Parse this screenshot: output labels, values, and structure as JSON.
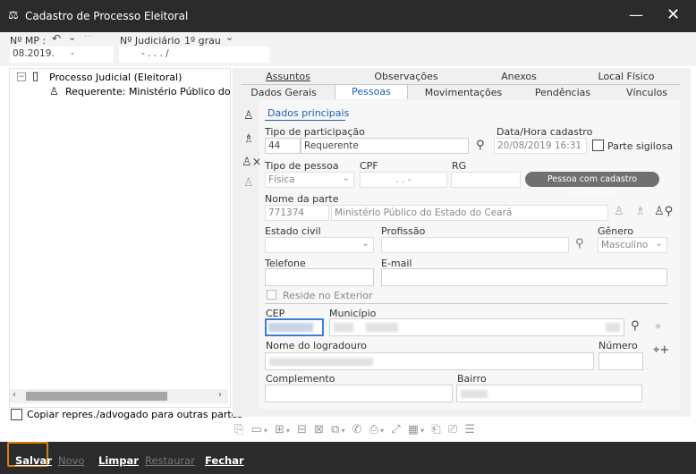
{
  "window": {
    "title": "Cadastro de Processo Eleitoral",
    "minimize_icon": "minimize-icon",
    "close_icon": "close-icon"
  },
  "header": {
    "mp_label": "Nº MP :",
    "mp_value": "08.2019.",
    "mp_value2": "-",
    "judiciario_label": "Nº Judiciário",
    "grau_label": "1º grau",
    "judiciario_value": "-    .    .  .    /"
  },
  "tree": {
    "root_label": "Processo Judicial (Eleitoral)",
    "child_label": "Requerente: Ministério Público do E",
    "copy_label": "Copiar repres./advogado para outras partes"
  },
  "tabs_row1": [
    "Assuntos",
    "Observações",
    "Anexos",
    "Local Físico"
  ],
  "tabs_row2": [
    "Dados Gerais",
    "Pessoas",
    "Movimentações",
    "Pendências",
    "Vínculos"
  ],
  "form": {
    "section_title": "Dados principais",
    "tipo_participacao_label": "Tipo de participação",
    "tipo_participacao_code": "44",
    "tipo_participacao_value": "Requerente",
    "data_hora_label": "Data/Hora cadastro",
    "data_hora_value": "20/08/2019 16:31",
    "parte_sigilosa_label": "Parte sigilosa",
    "tipo_pessoa_label": "Tipo de pessoa",
    "tipo_pessoa_value": "Física",
    "cpf_label": "CPF",
    "cpf_value": ".    .    -",
    "rg_label": "RG",
    "pessoa_controlado": "Pessoa com cadastro controlado",
    "nome_parte_label": "Nome da parte",
    "nome_parte_code": "771374",
    "nome_parte_value": "Ministério Público do Estado do Ceará",
    "estado_civil_label": "Estado civil",
    "profissao_label": "Profissão",
    "genero_label": "Gênero",
    "genero_value": "Masculino",
    "telefone_label": "Telefone",
    "email_label": "E-mail",
    "reside_exterior_label": "Reside no Exterior",
    "cep_label": "CEP",
    "municipio_label": "Município",
    "logradouro_label": "Nome do logradouro",
    "numero_label": "Número",
    "complemento_label": "Complemento",
    "bairro_label": "Bairro"
  },
  "bottom": {
    "salvar": "Salvar",
    "novo": "Novo",
    "limpar": "Limpar",
    "restaurar": "Restaurar",
    "fechar": "Fechar"
  },
  "colors": {
    "titlebar": "#2b2b2b",
    "accent": "#1a5fb4",
    "salvar_border": "#e07b12"
  }
}
